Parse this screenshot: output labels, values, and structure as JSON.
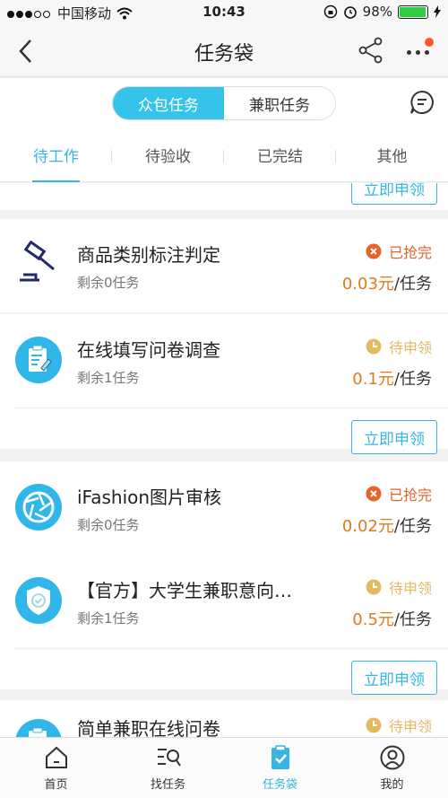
{
  "status_bar": {
    "carrier": "中国移动",
    "time": "10:43",
    "battery": "98%"
  },
  "nav": {
    "title": "任务袋"
  },
  "segment": {
    "tabs": [
      "众包任务",
      "兼职任务"
    ],
    "active": 0
  },
  "tabs": [
    "待工作",
    "待验收",
    "已完结",
    "其他"
  ],
  "apply_label": "立即申领",
  "price_unit": "/任务",
  "tasks": [
    {
      "title": "商品类别标注判定",
      "remain": "剩余0任务",
      "status": "已抢完",
      "price": "0.03元",
      "icon": "gavel-icon"
    },
    {
      "title": "在线填写问卷调查",
      "remain": "剩余1任务",
      "status": "待申领",
      "price": "0.1元",
      "icon": "clipboard-icon"
    },
    {
      "title": "iFashion图片审核",
      "remain": "剩余0任务",
      "status": "已抢完",
      "price": "0.02元",
      "icon": "aperture-icon"
    },
    {
      "title": "【官方】大学生兼职意向…",
      "remain": "剩余1任务",
      "status": "待申领",
      "price": "0.5元",
      "icon": "shield-icon"
    },
    {
      "title": "简单兼职在线问卷",
      "status": "待申领",
      "icon": "clipboard-icon"
    }
  ],
  "tabbar": [
    "首页",
    "找任务",
    "任务袋",
    "我的"
  ],
  "colors": {
    "accent": "#35b5e0",
    "grabbed": "#e8622a",
    "waiting": "#e3b964",
    "price": "#e07a1c"
  }
}
